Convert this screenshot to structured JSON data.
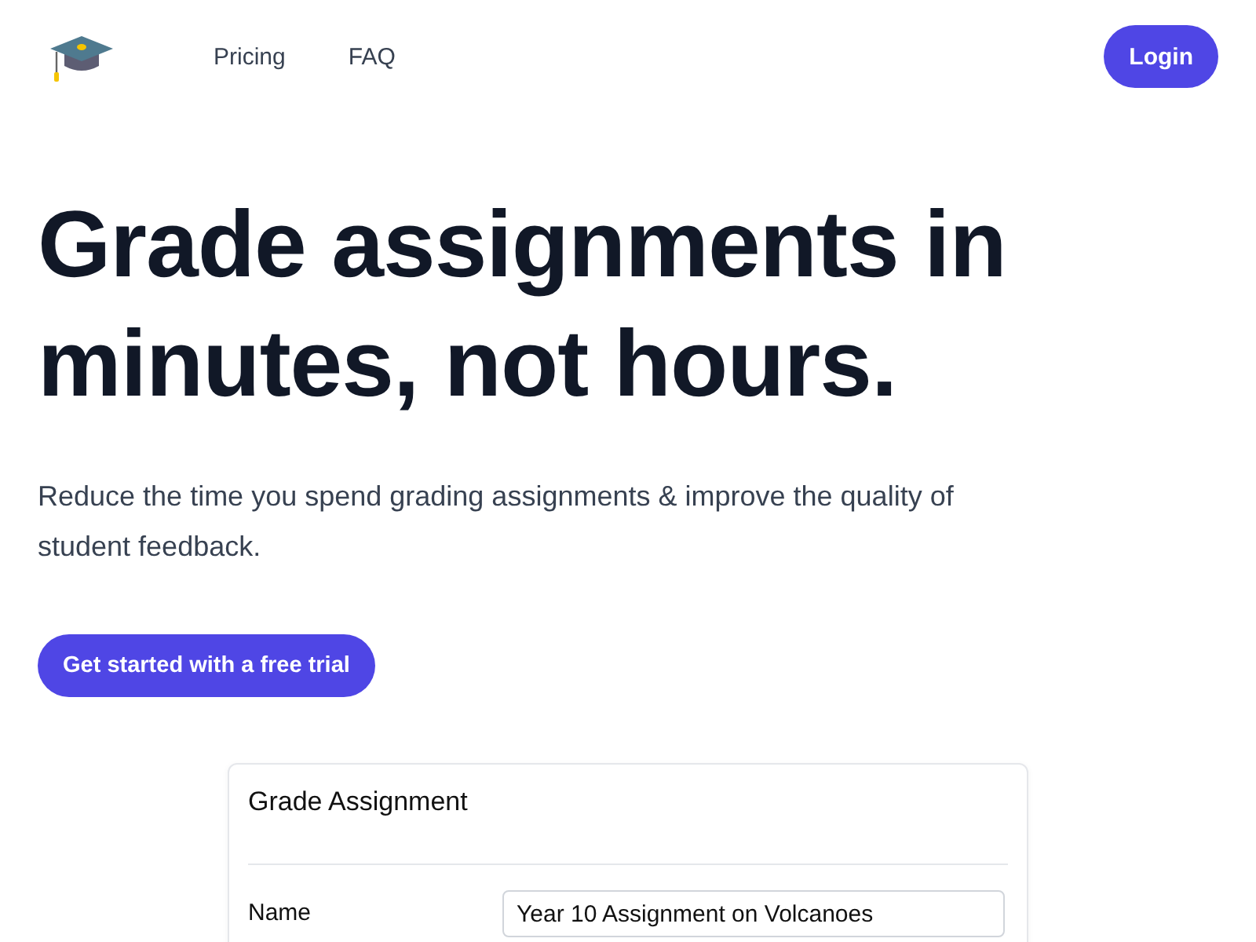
{
  "nav": {
    "links": [
      "Pricing",
      "FAQ"
    ],
    "login": "Login"
  },
  "hero": {
    "headline": "Grade assignments in minutes, not hours.",
    "subtitle": "Reduce the time you spend grading assignments & improve the quality of student feedback.",
    "cta": "Get started with a free trial"
  },
  "card": {
    "title": "Grade Assignment",
    "fields": [
      {
        "label": "Name",
        "value": "Year 10 Assignment on Volcanoes"
      }
    ]
  }
}
